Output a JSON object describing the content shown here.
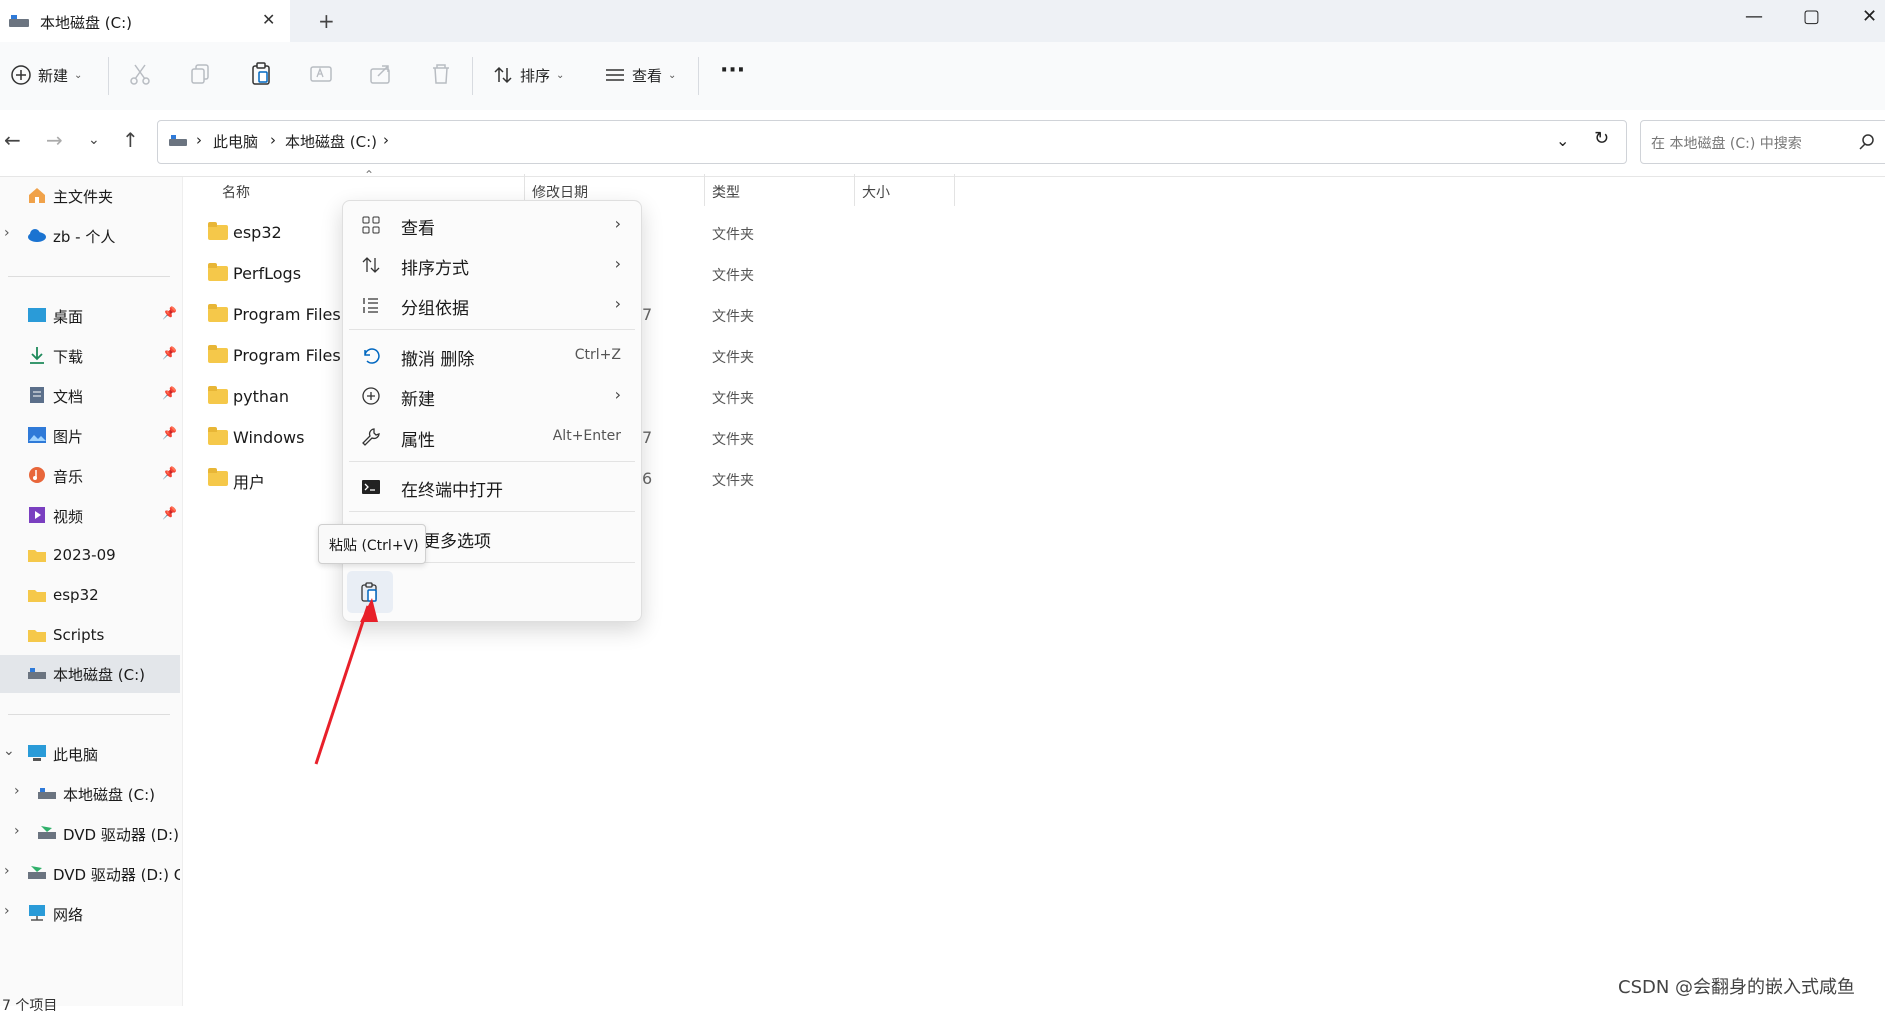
{
  "window": {
    "tab_title": "本地磁盘 (C:)",
    "tab_close": "✕",
    "new_tab": "+",
    "minimize": "—",
    "maximize": "▢",
    "close": "✕"
  },
  "toolbar": {
    "new_label": "新建",
    "sort_label": "排序",
    "view_label": "查看",
    "more_label": "···"
  },
  "address": {
    "crumbs": [
      "此电脑",
      "本地磁盘 (C:)"
    ],
    "search_placeholder": "在 本地磁盘 (C:) 中搜索"
  },
  "sidebar": {
    "items": [
      {
        "label": "主文件夹"
      },
      {
        "label": "zb - 个人"
      },
      {
        "label": "桌面"
      },
      {
        "label": "下载"
      },
      {
        "label": "文档"
      },
      {
        "label": "图片"
      },
      {
        "label": "音乐"
      },
      {
        "label": "视频"
      },
      {
        "label": "2023-09"
      },
      {
        "label": "esp32"
      },
      {
        "label": "Scripts"
      },
      {
        "label": "本地磁盘 (C:)"
      },
      {
        "label": "此电脑"
      },
      {
        "label": "本地磁盘 (C:)"
      },
      {
        "label": "DVD 驱动器 (D:) C"
      },
      {
        "label": "DVD 驱动器 (D:) CC"
      },
      {
        "label": "网络"
      }
    ]
  },
  "columns": {
    "name": "名称",
    "modified": "修改日期",
    "type": "类型",
    "size": "大小"
  },
  "files": [
    {
      "name": "esp32",
      "type": "文件夹",
      "date_fragment": ""
    },
    {
      "name": "PerfLogs",
      "type": "文件夹",
      "date_fragment": ""
    },
    {
      "name": "Program Files",
      "type": "文件夹",
      "date_fragment": "7"
    },
    {
      "name": "Program Files (",
      "type": "文件夹",
      "date_fragment": ""
    },
    {
      "name": "pythan",
      "type": "文件夹",
      "date_fragment": ""
    },
    {
      "name": "Windows",
      "type": "文件夹",
      "date_fragment": "7"
    },
    {
      "name": "用户",
      "type": "文件夹",
      "date_fragment": "6"
    }
  ],
  "context_menu": {
    "view": "查看",
    "sort": "排序方式",
    "group": "分组依据",
    "undo": "撤消 删除",
    "undo_shortcut": "Ctrl+Z",
    "new": "新建",
    "properties": "属性",
    "properties_shortcut": "Alt+Enter",
    "terminal": "在终端中打开",
    "more": "显示更多选项",
    "more_visible": "更多选项"
  },
  "tooltip": "粘贴 (Ctrl+V)",
  "status": "7 个项目",
  "watermark": "CSDN @会翻身的嵌入式咸鱼",
  "colors": {
    "accent": "#0067c0",
    "arrow": "#e8202a",
    "folder": "#f5c84a"
  }
}
